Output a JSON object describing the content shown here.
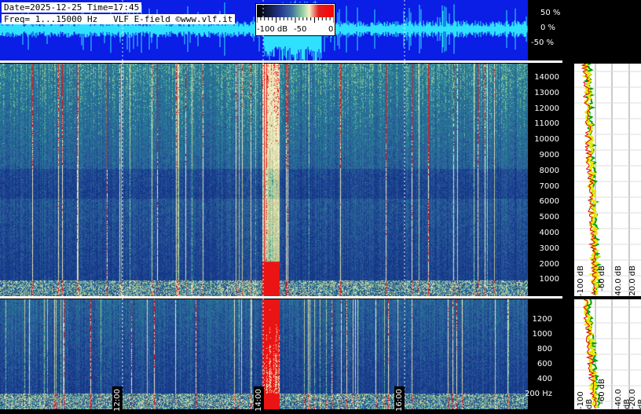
{
  "header": {
    "date_time": "Date=2025-12-25 Time=17:45",
    "freq_line": "Freq= 1...15000 Hz   VLF E-field ©www.vlf.it"
  },
  "colorscale": {
    "labels": [
      "-100 dB",
      "-50",
      "0"
    ],
    "colors": [
      "#000000",
      "#23368f",
      "#86c89c",
      "#f4f0c8",
      "#e02020"
    ]
  },
  "amplitude_scale": [
    "50 %",
    "0 %",
    "-50 %"
  ],
  "time_markers": [
    "12:00",
    "14:00",
    "16:00"
  ],
  "top_freq_axis": [
    "14000",
    "13000",
    "12000",
    "11000",
    "10000",
    "9000",
    "8000",
    "7000",
    "6000",
    "5000",
    "4000",
    "3000",
    "2000",
    "1000"
  ],
  "bottom_freq_axis": [
    "1200",
    "1000",
    "800",
    "600",
    "400",
    "200 Hz"
  ],
  "db_axis": [
    "-100 dB",
    "-60 dB",
    "-40.0 dB",
    "-20.0 dB"
  ],
  "db_axis_bottom": [
    "-100 dB",
    "-60 dB",
    "-40.0 dB",
    "-20.0 dB"
  ],
  "colors": {
    "wave_bg": "#0a1ee6",
    "waveform": "#30e0ff",
    "spec_dark": "#141c4a",
    "spec_mid": "#28408c",
    "burst": "#ff1010"
  }
}
